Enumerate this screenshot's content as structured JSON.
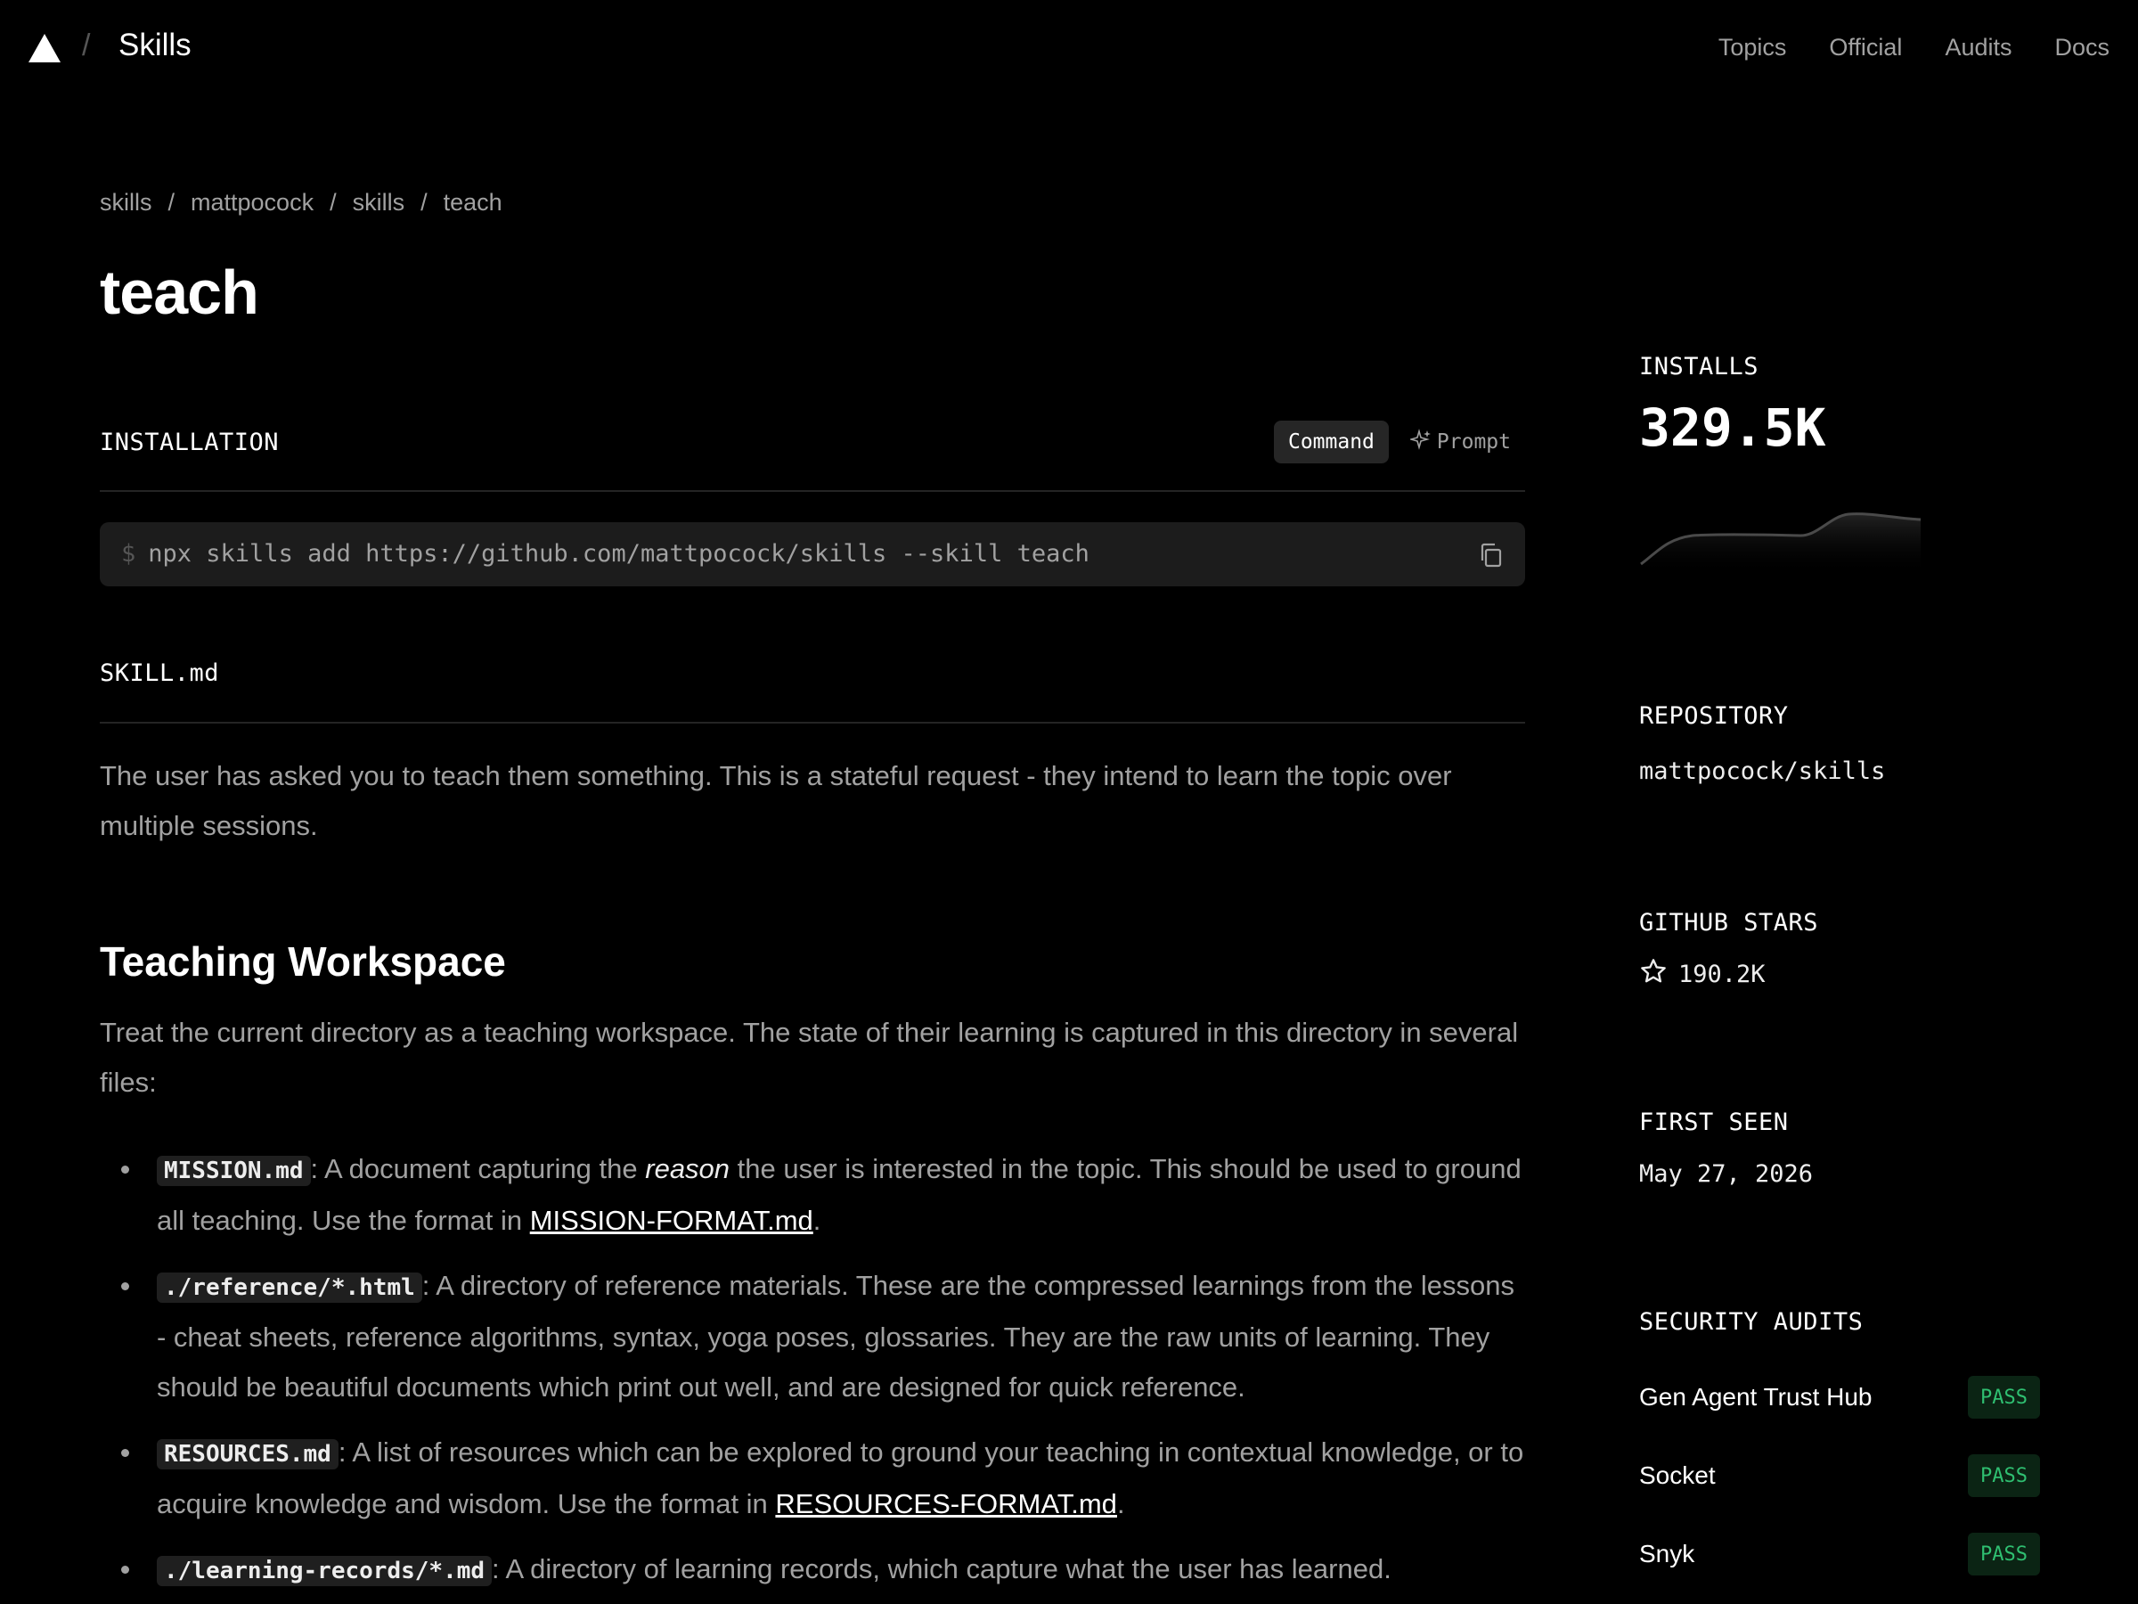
{
  "topbar": {
    "brand": "Skills",
    "nav": [
      "Topics",
      "Official",
      "Audits",
      "Docs"
    ]
  },
  "breadcrumb": [
    "skills",
    "mattpocock",
    "skills",
    "teach"
  ],
  "title": "teach",
  "installation": {
    "label": "INSTALLATION",
    "tabs": [
      "Command",
      "Prompt"
    ],
    "active_tab": "Command",
    "prompt": "$",
    "command": "npx skills add https://github.com/mattpocock/skills --skill teach"
  },
  "skill_file": {
    "label": "SKILL.md",
    "intro": "The user has asked you to teach them something. This is a stateful request - they intend to learn the topic over multiple sessions.",
    "heading": "Teaching Workspace",
    "workspace_text": "Treat the current directory as a teaching workspace. The state of their learning is captured in this directory in several files:",
    "items": [
      {
        "code": "MISSION.md",
        "pre": ": A document capturing the ",
        "em": "reason",
        "mid": " the user is interested in the topic. This should be used to ground all teaching. Use the format in ",
        "link": "MISSION-FORMAT.md",
        "post": "."
      },
      {
        "code": "./reference/*.html",
        "text": ": A directory of reference materials. These are the compressed learnings from the lessons - cheat sheets, reference algorithms, syntax, yoga poses, glossaries. They are the raw units of learning. They should be beautiful documents which print out well, and are designed for quick reference."
      },
      {
        "code": "RESOURCES.md",
        "pre": ": A list of resources which can be explored to ground your teaching in contextual knowledge, or to acquire knowledge and wisdom. Use the format in ",
        "link": "RESOURCES-FORMAT.md",
        "post": "."
      },
      {
        "code": "./learning-records/*.md",
        "text": ": A directory of learning records, which capture what the user has learned."
      }
    ]
  },
  "sidebar": {
    "installs_label": "INSTALLS",
    "installs_value": "329.5K",
    "repository_label": "REPOSITORY",
    "repository_value": "mattpocock/skills",
    "stars_label": "GITHUB STARS",
    "stars_value": "190.2K",
    "first_seen_label": "FIRST SEEN",
    "first_seen_value": "May 27, 2026",
    "audits_label": "SECURITY AUDITS",
    "audits": [
      {
        "name": "Gen Agent Trust Hub",
        "status": "PASS"
      },
      {
        "name": "Socket",
        "status": "PASS"
      },
      {
        "name": "Snyk",
        "status": "PASS"
      }
    ]
  },
  "colors": {
    "background": "#000000",
    "pass_text": "#2fbf71",
    "pass_bg": "#0b2414"
  }
}
